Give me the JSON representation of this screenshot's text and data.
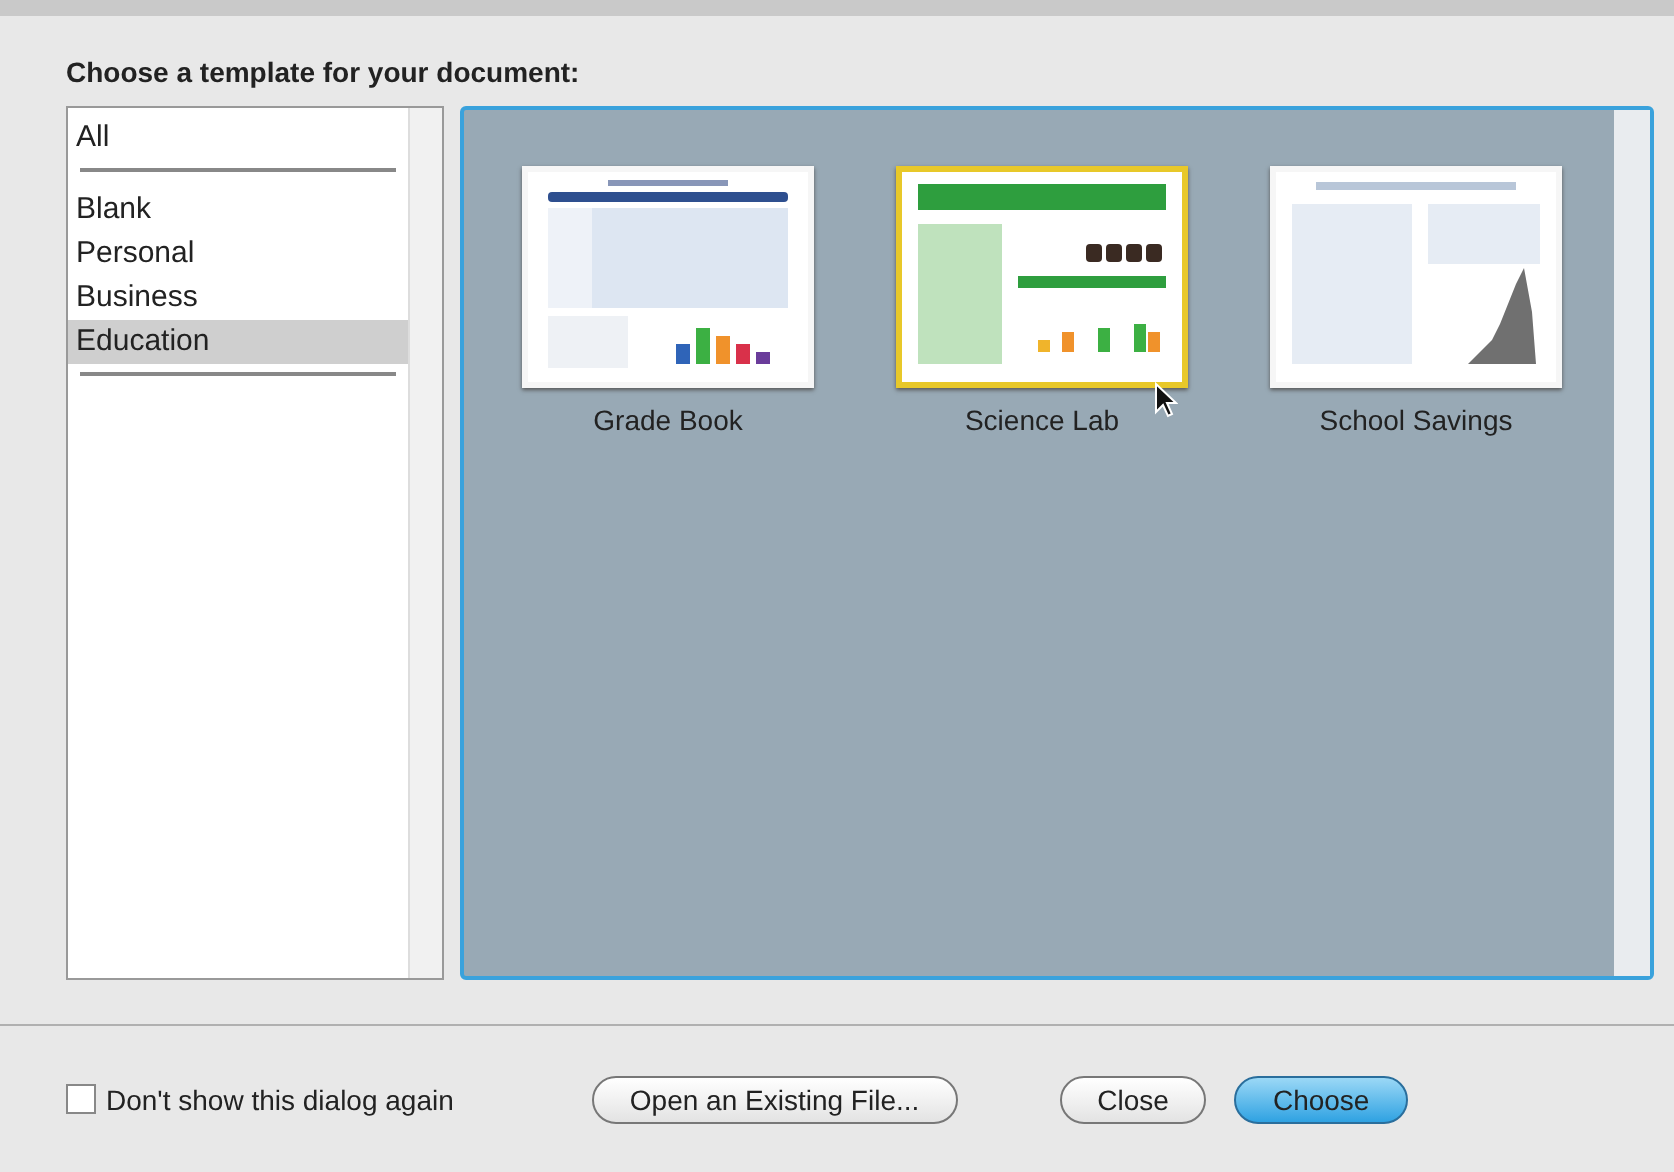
{
  "heading": "Choose a template for your document:",
  "categories": [
    [
      {
        "label": "All",
        "selected": false
      }
    ],
    [
      {
        "label": "Blank",
        "selected": false
      },
      {
        "label": "Personal",
        "selected": false
      },
      {
        "label": "Business",
        "selected": false
      },
      {
        "label": "Education",
        "selected": true
      }
    ]
  ],
  "templates": [
    {
      "name": "Grade Book",
      "kind": "table",
      "selected": false
    },
    {
      "name": "Science Lab",
      "kind": "poster",
      "selected": true
    },
    {
      "name": "School Savings",
      "kind": "ledger",
      "selected": false
    }
  ],
  "dont_show_again": {
    "label": "Don't show this dialog again",
    "checked": false
  },
  "buttons": [
    {
      "label": "Open an Existing File...",
      "kind": "normal"
    },
    {
      "label": "Close",
      "kind": "normal"
    },
    {
      "label": "Choose",
      "kind": "default"
    }
  ]
}
